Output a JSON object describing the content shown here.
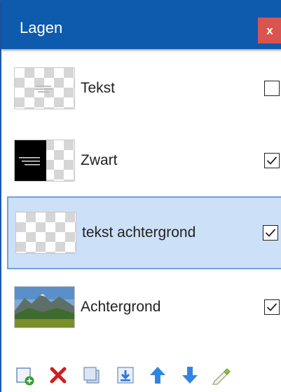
{
  "window": {
    "title": "Lagen",
    "close_label": "x"
  },
  "layers": [
    {
      "name": "Tekst",
      "visible": false,
      "selected": false,
      "thumbnail": "transparent-text"
    },
    {
      "name": "Zwart",
      "visible": true,
      "selected": false,
      "thumbnail": "black-with-text"
    },
    {
      "name": "tekst achtergrond",
      "visible": true,
      "selected": true,
      "thumbnail": "transparent"
    },
    {
      "name": "Achtergrond",
      "visible": true,
      "selected": false,
      "thumbnail": "landscape"
    }
  ],
  "toolbar": {
    "icons": [
      "add-layer-icon",
      "delete-layer-icon",
      "duplicate-layer-icon",
      "merge-down-icon",
      "move-up-icon",
      "move-down-icon",
      "layer-properties-icon"
    ]
  },
  "colors": {
    "titlebar": "#0e5aad",
    "close_button": "#d9534f",
    "selection_fill": "#cce0f7",
    "selection_border": "#6ea2e0"
  }
}
